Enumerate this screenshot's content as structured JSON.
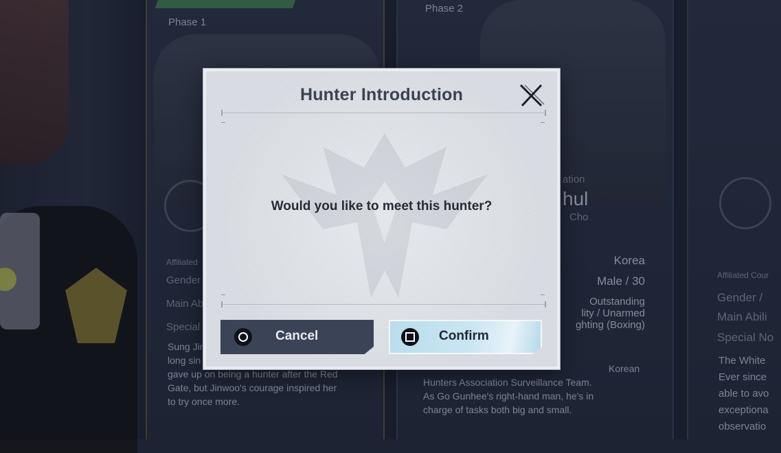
{
  "dialog": {
    "title": "Hunter Introduction",
    "message": "Would you like to meet this hunter?",
    "cancel_label": "Cancel",
    "confirm_label": "Confirm",
    "cancel_icon": "circle-button-icon",
    "confirm_icon": "square-button-icon",
    "close_icon": "close-x-icon"
  },
  "cards": {
    "left": {
      "phase": "Phase 1",
      "affiliated_label": "Affiliated",
      "gender_label": "Gender",
      "main_ability_label": "Main Ab",
      "special_label": "Special",
      "description_lines": [
        "Sung Jin",
        "long sin",
        "gave up on being a hunter after the Red",
        "Gate, but Jinwoo's courage inspired her",
        "to try once more."
      ]
    },
    "mid": {
      "phase": "Phase 2",
      "affiliation_fragment": "ation",
      "name_fragment": "hul",
      "subname_fragment": "Cho",
      "country": "Korea",
      "gender_age": "Male / 30",
      "ability_lines": [
        "Outstanding",
        "lity / Unarmed",
        "ghting (Boxing)"
      ],
      "description_lines": [
        "Korean",
        "Hunters Association Surveillance Team.",
        "As Go Gunhee's right-hand man, he's in",
        "charge of tasks both big and small."
      ]
    },
    "right": {
      "affiliated_label": "Affiliated Cour",
      "gender_label": "Gender /",
      "main_ability_label": "Main Abili",
      "special_label": "Special No",
      "description_lines": [
        "The White",
        "Ever since",
        "able to avo",
        "exceptiona",
        "observatio"
      ]
    }
  },
  "colors": {
    "dialog_bg": "#d9dde3",
    "cancel_bg": "#3b4356",
    "confirm_bg": "#cbe6f3",
    "title_text": "#3b4252",
    "background": "#1d2333"
  }
}
